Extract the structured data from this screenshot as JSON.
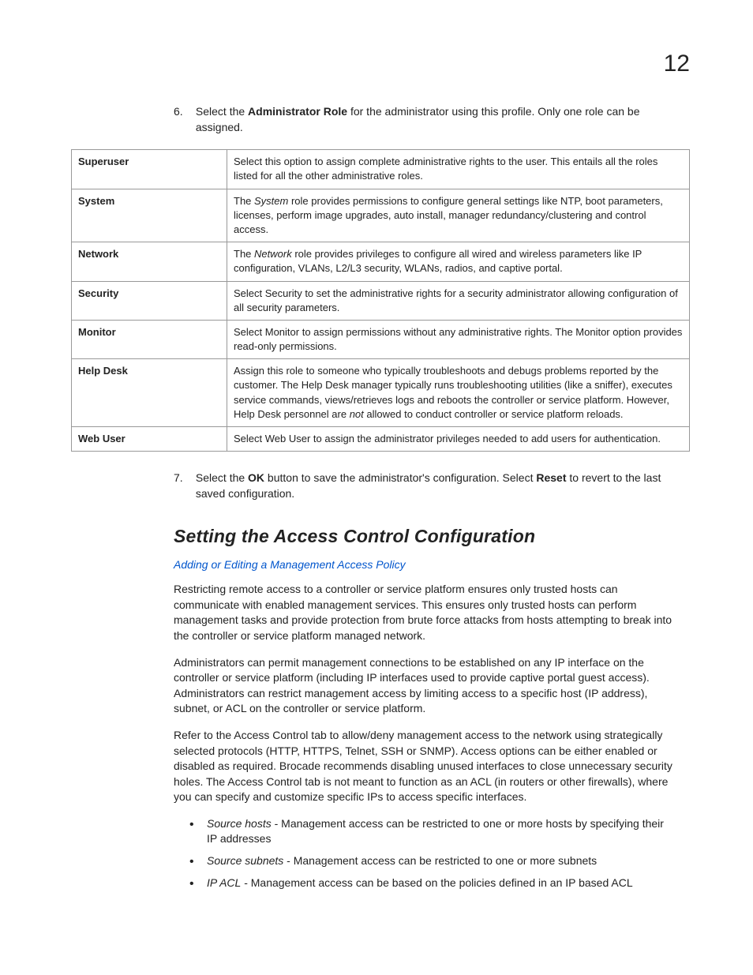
{
  "chapter": "12",
  "step6": {
    "num": "6.",
    "prefix": "Select the ",
    "bold": "Administrator Role",
    "suffix": " for the administrator using this profile. Only one role can be assigned."
  },
  "roles": [
    {
      "label": "Superuser",
      "desc": "Select this option to assign complete administrative rights to the user. This entails all the roles listed for all the other administrative roles."
    },
    {
      "label": "System",
      "desc_pre": "The ",
      "desc_ital": "System",
      "desc_post": " role provides permissions to configure general settings like NTP, boot parameters, licenses, perform image upgrades, auto install, manager redundancy/clustering and control access."
    },
    {
      "label": "Network",
      "desc_pre": "The ",
      "desc_ital": "Network",
      "desc_post": " role provides privileges to configure all wired and wireless parameters like IP configuration, VLANs, L2/L3 security, WLANs, radios, and captive portal."
    },
    {
      "label": "Security",
      "desc": "Select Security to set the administrative rights for a security administrator allowing configuration of all security parameters."
    },
    {
      "label": "Monitor",
      "desc": "Select Monitor to assign permissions without any administrative rights. The Monitor option provides read-only permissions."
    },
    {
      "label": "Help Desk",
      "desc_pre": "Assign this role to someone who typically troubleshoots and debugs problems reported by the customer. The Help Desk manager typically runs troubleshooting utilities (like a sniffer), executes service commands, views/retrieves logs and reboots the controller or service platform. However, Help Desk personnel are ",
      "desc_ital": "not",
      "desc_post": " allowed to conduct controller or service platform reloads."
    },
    {
      "label": "Web User",
      "desc": "Select Web User to assign the administrator privileges needed to add users for authentication."
    }
  ],
  "step7": {
    "num": "7.",
    "p1": "Select the ",
    "b1": "OK",
    "p2": " button to save the administrator's configuration. Select ",
    "b2": "Reset",
    "p3": " to revert to the last saved configuration."
  },
  "section_heading": "Setting the Access Control Configuration",
  "link_text": "Adding or Editing a Management Access Policy",
  "para1": "Restricting remote access to a controller or service platform ensures only trusted hosts can communicate with enabled management services. This ensures only trusted hosts can perform management tasks and provide protection from brute force attacks from hosts attempting to break into the controller or service platform managed network.",
  "para2": "Administrators can permit management connections to be established on any IP interface on the controller or service platform (including IP interfaces used to provide captive portal guest access). Administrators can restrict management access by limiting access to a specific host (IP address), subnet, or ACL on the controller or service platform.",
  "para3": "Refer to the Access Control tab to allow/deny management access to the network using strategically selected protocols (HTTP, HTTPS, Telnet, SSH or SNMP). Access options can be either enabled or disabled as required. Brocade recommends disabling unused interfaces to close unnecessary security holes. The Access Control tab is not meant to function as an ACL (in routers or other firewalls), where you can specify and customize specific IPs to access specific interfaces.",
  "bullets": [
    {
      "ital": "Source hosts",
      "rest": " - Management access can be restricted to one or more hosts by specifying their IP addresses"
    },
    {
      "ital": "Source subnets",
      "rest": " - Management access can be restricted to one or more subnets"
    },
    {
      "ital": "IP ACL",
      "rest": " - Management access can be based on the policies defined in an IP based ACL"
    }
  ]
}
